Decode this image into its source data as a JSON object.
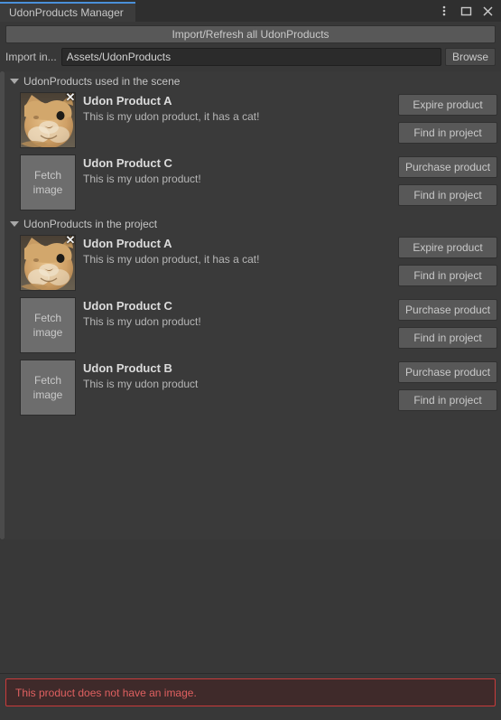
{
  "window": {
    "tab_title": "UdonProducts Manager",
    "accent_color": "#4a90d9",
    "controls": [
      {
        "name": "more-options",
        "glyph": "kebab"
      },
      {
        "name": "maximize",
        "glyph": "square"
      },
      {
        "name": "close",
        "glyph": "x"
      }
    ]
  },
  "toolbar": {
    "import_refresh_label": "Import/Refresh all UdonProducts",
    "path_label": "Import in...",
    "path_value": "Assets/UdonProducts",
    "path_placeholder": "Assets/UdonProducts",
    "browse_label": "Browse"
  },
  "sections": [
    {
      "id": "scene",
      "label": "UdonProducts used in the scene",
      "expanded": true,
      "products": [
        {
          "title": "Udon Product A",
          "description": "This is my udon product, it has a cat!",
          "thumb_type": "image",
          "thumb_label": "",
          "has_remove": true,
          "remove_glyph": "✕",
          "actions": [
            "Expire product",
            "Find in project"
          ]
        },
        {
          "title": "Udon Product C",
          "description": "This is my udon product!",
          "thumb_type": "fetch",
          "thumb_label": "Fetch image",
          "has_remove": false,
          "remove_glyph": "",
          "actions": [
            "Purchase product",
            "Find in project"
          ]
        }
      ]
    },
    {
      "id": "project",
      "label": "UdonProducts in the project",
      "expanded": true,
      "products": [
        {
          "title": "Udon Product A",
          "description": "This is my udon product, it has a cat!",
          "thumb_type": "image",
          "thumb_label": "",
          "has_remove": true,
          "remove_glyph": "✕",
          "actions": [
            "Expire product",
            "Find in project"
          ]
        },
        {
          "title": "Udon Product C",
          "description": "This is my udon product!",
          "thumb_type": "fetch",
          "thumb_label": "Fetch image",
          "has_remove": false,
          "remove_glyph": "",
          "actions": [
            "Purchase product",
            "Find in project"
          ]
        },
        {
          "title": "Udon Product B",
          "description": "This is my udon product",
          "thumb_type": "fetch",
          "thumb_label": "Fetch image",
          "has_remove": false,
          "remove_glyph": "",
          "actions": [
            "Purchase product",
            "Find in project"
          ]
        }
      ]
    }
  ],
  "status": {
    "error_message": "This product does not have an image.",
    "error_color": "#df6060",
    "error_border": "#c93b3b"
  }
}
